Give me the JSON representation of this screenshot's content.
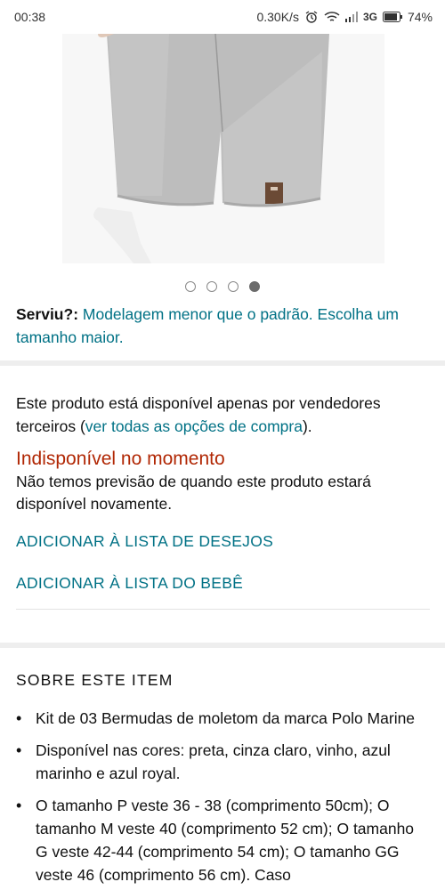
{
  "status_bar": {
    "time": "00:38",
    "net_speed": "0.30K/s",
    "network_type": "3G",
    "battery": "74%"
  },
  "gallery": {
    "image_icon": "product-photo-shorts",
    "dots_count": 4,
    "active_dot_index": 3
  },
  "fit": {
    "label": "Serviu?:",
    "text": " Modelagem menor que o padrão. Escolha um tamanho maior."
  },
  "availability": {
    "prefix": "Este produto está disponível apenas por vendedores terceiros (",
    "link": "ver todas as opções de compra",
    "suffix": ").",
    "unavailable_title": "Indisponível no momento",
    "no_forecast": "Não temos previsão de quando este produto estará disponível novamente."
  },
  "actions": {
    "wishlist": "ADICIONAR À LISTA DE DESEJOS",
    "baby_list": "ADICIONAR À LISTA DO BEBÊ"
  },
  "about": {
    "heading": "SOBRE ESTE ITEM",
    "bullets": [
      "Kit de 03 Bermudas de moletom da marca Polo Marine",
      "Disponível nas cores: preta, cinza claro, vinho, azul marinho e azul royal.",
      "O tamanho P veste 36 - 38 (comprimento 50cm); O tamanho M veste 40 (comprimento 52 cm); O tamanho G veste 42-44 (comprimento 54 cm); O tamanho GG veste 46 (comprimento 56 cm). Caso"
    ]
  },
  "colors": {
    "link": "#007185",
    "unavailable": "#b12704",
    "divider": "#eeeeee"
  }
}
